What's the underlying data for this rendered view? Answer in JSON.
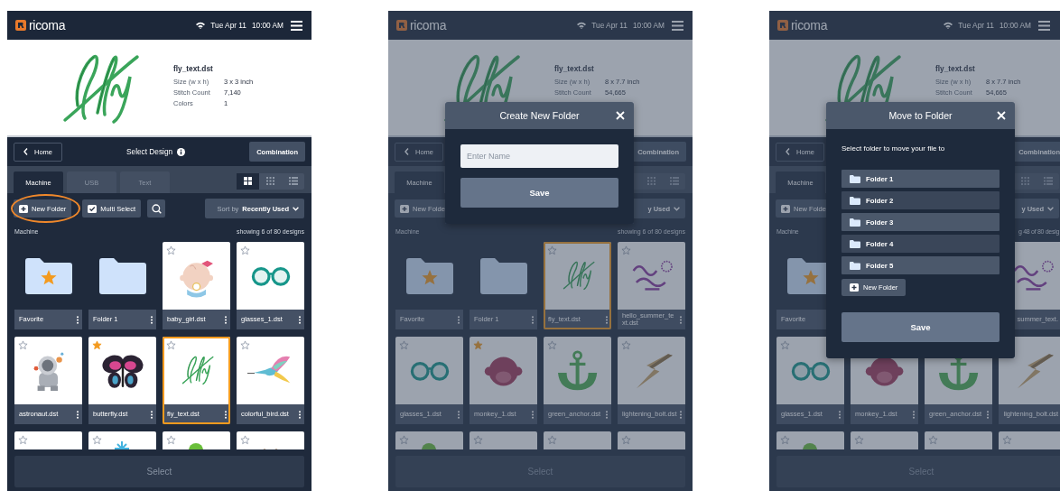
{
  "screens": [
    {
      "dimmed": false,
      "header": {
        "logo": "ricoma",
        "date": "Tue Apr 11",
        "time": "10:00 AM"
      },
      "preview": {
        "name": "fly_text.dst",
        "details": [
          {
            "label": "Size (w x h)",
            "value": "3 x 3 inch"
          },
          {
            "label": "Stitch Count",
            "value": "7,140"
          },
          {
            "label": "Colors",
            "value": "1"
          }
        ]
      },
      "toolbar": {
        "back": "Home",
        "title": "Select Design",
        "action": "Combination"
      },
      "tabs": [
        {
          "label": "Machine",
          "selected": true
        },
        {
          "label": "USB",
          "selected": false
        },
        {
          "label": "Text",
          "selected": false
        }
      ],
      "views": [
        {
          "kind": "tiles",
          "selected": true
        },
        {
          "kind": "grid",
          "selected": false
        },
        {
          "kind": "list",
          "selected": false
        }
      ],
      "actions": {
        "new_folder": {
          "label": "New Folder",
          "highlighted": true
        },
        "multi_select": "Multi Select",
        "search": true,
        "sort": {
          "prefix": "Sort by",
          "value": "Recently Used"
        }
      },
      "location": "Machine",
      "count": "showing 6 of 80 designs",
      "items": [
        {
          "kind": "folder",
          "label": "Favorite",
          "starred": true,
          "selected": false
        },
        {
          "kind": "folder",
          "label": "Folder 1",
          "starred": false,
          "selected": false
        },
        {
          "kind": "design",
          "label": "baby_girl.dst",
          "starred": false,
          "selected": false
        },
        {
          "kind": "design",
          "label": "glasses_1.dst",
          "starred": false,
          "selected": false
        },
        {
          "kind": "design",
          "label": "astronaut.dst",
          "starred": false,
          "selected": false
        },
        {
          "kind": "design",
          "label": "butterfly.dst",
          "starred": true,
          "selected": false
        },
        {
          "kind": "design",
          "label": "fly_text.dst",
          "starred": false,
          "selected": true
        },
        {
          "kind": "design",
          "label": "colorful_bird.dst",
          "starred": false,
          "selected": false
        },
        {
          "kind": "design",
          "starred": false,
          "selected": false
        },
        {
          "kind": "design",
          "starred": false,
          "selected": false
        },
        {
          "kind": "design",
          "starred": false,
          "selected": false
        },
        {
          "kind": "design",
          "starred": false,
          "selected": false
        }
      ],
      "select_button": {
        "label": "Select",
        "disabled": true
      }
    },
    {
      "dimmed": true,
      "header": {
        "logo": "ricoma",
        "date": "Tue Apr 11",
        "time": "10:00 AM"
      },
      "preview": {
        "name": "fly_text.dst",
        "details": [
          {
            "label": "Size (w x h)",
            "value": "8 x 7.7 inch"
          },
          {
            "label": "Stitch Count",
            "value": "54,665"
          }
        ]
      },
      "toolbar": {
        "back": "Home",
        "action": "Combination"
      },
      "tabs": [
        {
          "label": "Machine",
          "selected": true
        }
      ],
      "views": [
        {
          "kind": "covered"
        },
        {
          "kind": "grid",
          "selected": false
        },
        {
          "kind": "list",
          "selected": false
        }
      ],
      "actions": {
        "new_folder": {
          "label": "New Folde",
          "highlighted": false
        },
        "search": false,
        "sort": {
          "value": "y Used"
        }
      },
      "location": "Machine",
      "count": "showing 6 of 80 designs",
      "items": [
        {
          "kind": "folder",
          "label": "Favorite",
          "starred": true,
          "selected": false
        },
        {
          "kind": "folder",
          "label": "Folder 1",
          "starred": false,
          "selected": false
        },
        {
          "kind": "design",
          "label": "fly_text.dst",
          "starred": false,
          "selected": true
        },
        {
          "kind": "design",
          "label": "hello_summer_text.dst",
          "starred": false,
          "selected": false
        },
        {
          "kind": "design",
          "label": "glasses_1.dst",
          "starred": false,
          "selected": false
        },
        {
          "kind": "design",
          "label": "monkey_1.dst",
          "starred": true,
          "selected": false
        },
        {
          "kind": "design",
          "label": "green_anchor.dst",
          "starred": false,
          "selected": false
        },
        {
          "kind": "design",
          "label": "lightening_bolt.dst",
          "starred": false,
          "selected": false
        },
        {
          "kind": "design",
          "starred": false,
          "selected": false
        },
        {
          "kind": "design",
          "starred": false,
          "selected": false
        },
        {
          "kind": "design",
          "starred": false,
          "selected": false
        },
        {
          "kind": "design",
          "starred": false,
          "selected": false
        }
      ],
      "select_button": {
        "label": "Select",
        "disabled": true
      },
      "modal": {
        "kind": "create-folder",
        "title": "Create New Folder",
        "placeholder": "Enter Name",
        "save": "Save"
      }
    },
    {
      "dimmed": true,
      "header": {
        "logo": "ricoma",
        "date": "Tue Apr 11",
        "time": "10:00 AM"
      },
      "preview": {
        "name": "fly_text.dst",
        "details": [
          {
            "label": "Size (w x h)",
            "value": "8 x 7.7 inch"
          },
          {
            "label": "Stitch Count",
            "value": "54,665"
          }
        ]
      },
      "toolbar": {
        "back": "Home",
        "action": "Combination"
      },
      "tabs": [
        {
          "label": "Machine",
          "selected": true
        }
      ],
      "views": [
        {
          "kind": "covered"
        },
        {
          "kind": "grid",
          "selected": false
        },
        {
          "kind": "list",
          "selected": false
        }
      ],
      "actions": {
        "new_folder": {
          "label": "New Folde",
          "highlighted": false
        },
        "search": false,
        "sort": {
          "value": "y Used"
        }
      },
      "location": "Machine",
      "count": "g 48 of 80 desig",
      "items": [
        {
          "kind": "folder",
          "label": "Favorite",
          "starred": true,
          "selected": false
        },
        {
          "kind": "covered"
        },
        {
          "kind": "covered"
        },
        {
          "kind": "design",
          "label": "summer_text.",
          "selected": false
        },
        {
          "kind": "design",
          "label": "glasses_1.dst",
          "starred": false,
          "selected": false
        },
        {
          "kind": "design",
          "label": "monkey_1.dst",
          "selected": false
        },
        {
          "kind": "design",
          "label": "green_anchor.dst",
          "selected": false
        },
        {
          "kind": "design",
          "label": "lightening_bolt.dst",
          "selected": false
        },
        {
          "kind": "design",
          "starred": false,
          "selected": false
        },
        {
          "kind": "design",
          "starred": false,
          "selected": false
        },
        {
          "kind": "design",
          "starred": false,
          "selected": false
        },
        {
          "kind": "design",
          "starred": false,
          "selected": false
        }
      ],
      "select_button": {
        "label": "Select",
        "disabled": true
      },
      "modal": {
        "kind": "move-folder",
        "title": "Move to Folder",
        "prompt": "Select folder to move your file to",
        "folders": [
          {
            "label": "Folder 1",
            "selected": false
          },
          {
            "label": "Folder 2",
            "selected": false
          },
          {
            "label": "Folder 3",
            "selected": false
          },
          {
            "label": "Folder 4",
            "selected": false
          },
          {
            "label": "Folder 5",
            "selected": false
          }
        ],
        "new_folder": "New Folder",
        "save": "Save"
      }
    }
  ]
}
